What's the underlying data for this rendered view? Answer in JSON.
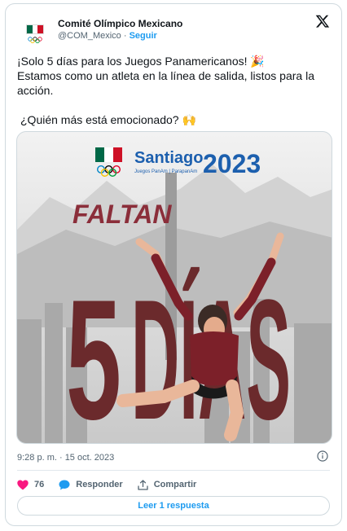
{
  "account": {
    "name": "Comité Olímpico Mexicano",
    "handle": "@COM_Mexico",
    "separator": "·",
    "follow_label": "Seguir"
  },
  "tweet": {
    "line1": "¡Solo 5 días para los Juegos Panamericanos! 🎉",
    "line2": "Estamos como un atleta en la línea de salida, listos para la acción.",
    "line3": "¿Quién más está emocionado? 🙌"
  },
  "media": {
    "brand_santiago": "Santiago",
    "brand_year": "2023",
    "brand_sub": "Juegos PanAm | ParapanAm",
    "headline": "FALTAN",
    "big_number": "5",
    "big_word": "DÍAS"
  },
  "meta": {
    "timestamp": "9:28 p. m. · 15 oct. 2023"
  },
  "actions": {
    "likes": "76",
    "reply_label": "Responder",
    "share_label": "Compartir",
    "read_replies": "Leer 1 respuesta"
  },
  "colors": {
    "accent": "#1d9bf0",
    "heart": "#f91880",
    "maroon": "#6b2a2c"
  }
}
